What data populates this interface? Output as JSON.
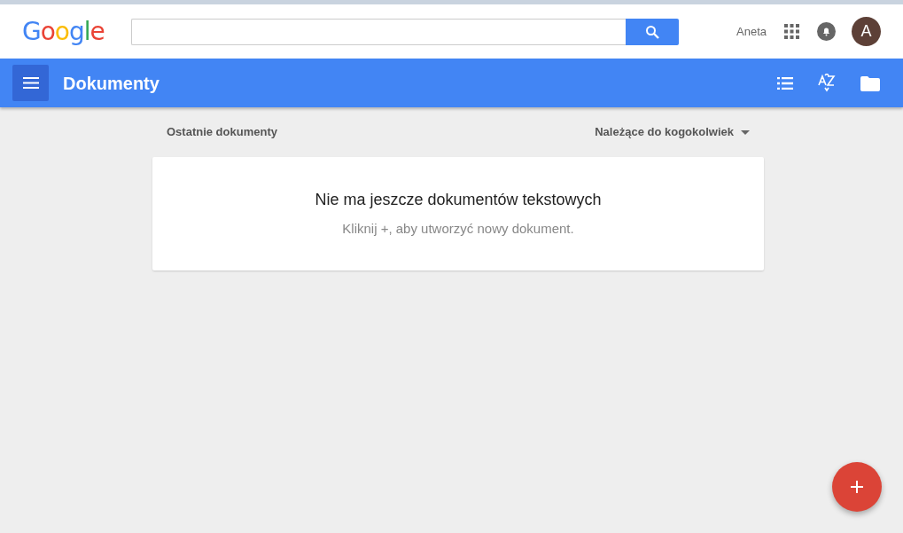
{
  "header": {
    "logo": "Google",
    "user_name": "Aneta",
    "avatar_letter": "A"
  },
  "toolbar": {
    "title": "Dokumenty"
  },
  "section": {
    "title": "Ostatnie dokumenty",
    "owner_filter": "Należące do kogokolwiek"
  },
  "empty_state": {
    "heading": "Nie ma jeszcze dokumentów tekstowych",
    "hint": "Kliknij +, aby utworzyć nowy dokument."
  }
}
